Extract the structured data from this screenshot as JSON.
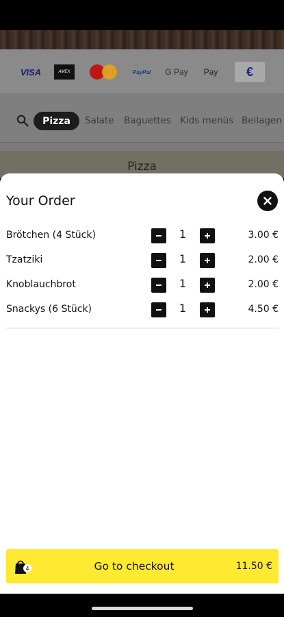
{
  "payments": {
    "visa": "VISA",
    "amex": "AMEX",
    "mastercard": "MasterCard",
    "paypal": "PayPal",
    "gpay": "G Pay",
    "applepay": "Pay",
    "cash": "€"
  },
  "categories": {
    "active": "Pizza",
    "items": [
      "Salate",
      "Baguettes",
      "Kids menüs",
      "Beilagen"
    ]
  },
  "section_title": "Pizza",
  "order": {
    "title": "Your Order",
    "items": [
      {
        "name": "Brötchen (4 Stück)",
        "qty": "1",
        "price": "3.00 €"
      },
      {
        "name": "Tzatziki",
        "qty": "1",
        "price": "2.00 €"
      },
      {
        "name": "Knoblauchbrot",
        "qty": "1",
        "price": "2.00 €"
      },
      {
        "name": "Snackys (6 Stück)",
        "qty": "1",
        "price": "4.50 €"
      }
    ]
  },
  "checkout": {
    "label": "Go to checkout",
    "total": "11.50 €",
    "count": "4"
  },
  "colors": {
    "accent": "#ffe931",
    "dark": "#111111"
  }
}
